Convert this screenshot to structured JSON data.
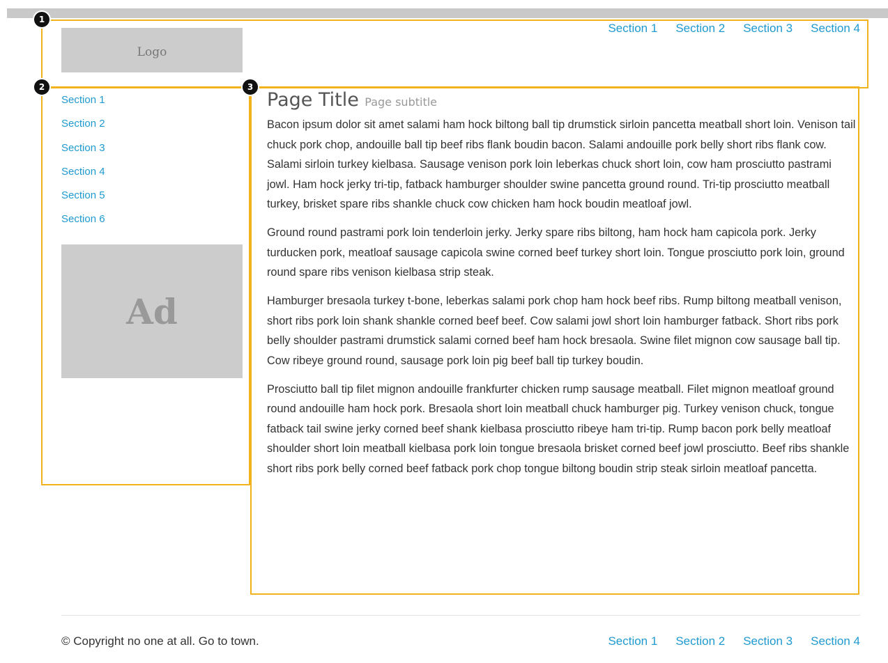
{
  "badges": [
    "1",
    "2",
    "3"
  ],
  "header": {
    "logo": "Logo",
    "nav": [
      "Section 1",
      "Section 2",
      "Section 3",
      "Section 4"
    ]
  },
  "sidebar": {
    "nav": [
      "Section 1",
      "Section 2",
      "Section 3",
      "Section 4",
      "Section 5",
      "Section 6"
    ],
    "ad": "Ad"
  },
  "main": {
    "title": "Page Title",
    "subtitle": "Page subtitle",
    "paragraphs": [
      "Bacon ipsum dolor sit amet salami ham hock biltong ball tip drumstick sirloin pancetta meatball short loin. Venison tail chuck pork chop, andouille ball tip beef ribs flank boudin bacon. Salami andouille pork belly short ribs flank cow. Salami sirloin turkey kielbasa. Sausage venison pork loin leberkas chuck short loin, cow ham prosciutto pastrami jowl. Ham hock jerky tri-tip, fatback hamburger shoulder swine pancetta ground round. Tri-tip prosciutto meatball turkey, brisket spare ribs shankle chuck cow chicken ham hock boudin meatloaf jowl.",
      "Ground round pastrami pork loin tenderloin jerky. Jerky spare ribs biltong, ham hock ham capicola pork. Jerky turducken pork, meatloaf sausage capicola swine corned beef turkey short loin. Tongue prosciutto pork loin, ground round spare ribs venison kielbasa strip steak.",
      "Hamburger bresaola turkey t-bone, leberkas salami pork chop ham hock beef ribs. Rump biltong meatball venison, short ribs pork loin shank shankle corned beef beef. Cow salami jowl short loin hamburger fatback. Short ribs pork belly shoulder pastrami drumstick salami corned beef ham hock bresaola. Swine filet mignon cow sausage ball tip. Cow ribeye ground round, sausage pork loin pig beef ball tip turkey boudin.",
      "Prosciutto ball tip filet mignon andouille frankfurter chicken rump sausage meatball. Filet mignon meatloaf ground round andouille ham hock pork. Bresaola short loin meatball chuck hamburger pig. Turkey venison chuck, tongue fatback tail swine jerky corned beef shank kielbasa prosciutto ribeye ham tri-tip. Rump bacon pork belly meatloaf shoulder short loin meatball kielbasa pork loin tongue bresaola brisket corned beef jowl prosciutto. Beef ribs shankle short ribs pork belly corned beef fatback pork chop tongue biltong boudin strip steak sirloin meatloaf pancetta."
    ]
  },
  "footer": {
    "copyright": "© Copyright no one at all. Go to town.",
    "nav": [
      "Section 1",
      "Section 2",
      "Section 3",
      "Section 4"
    ]
  },
  "colors": {
    "annotation_border": "#f2b21c",
    "link": "#1f9ad0",
    "placeholder": "#cccccc",
    "badge": "#111111"
  }
}
